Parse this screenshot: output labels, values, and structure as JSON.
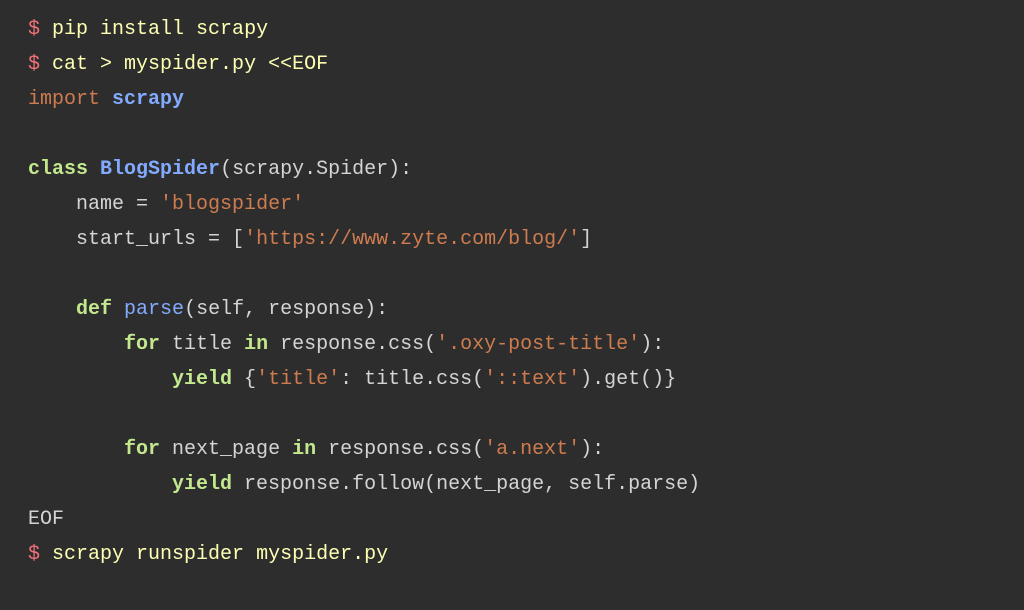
{
  "shell": {
    "prompt": "$",
    "line1_cmd": "pip install scrapy",
    "line2_cmd": "cat > myspider.py <<EOF",
    "line_last": "scrapy runspider myspider.py"
  },
  "py": {
    "kw_import": "import",
    "mod_scrapy": "scrapy",
    "kw_class": "class",
    "class_name": "BlogSpider",
    "base_mod": "scrapy",
    "base_cls": "Spider",
    "attr_name": "name",
    "eq": " = ",
    "name_val": "'blogspider'",
    "attr_urls": "start_urls",
    "urls_open": " = [",
    "urls_val": "'https://www.zyte.com/blog/'",
    "urls_close": "]",
    "kw_def": "def",
    "fn_parse": "parse",
    "parse_args_open": "(",
    "arg_self": "self",
    "comma_sp": ", ",
    "arg_response": "response",
    "parse_args_close": "):",
    "kw_for": "for",
    "var_title": "title",
    "kw_in": "in",
    "resp_css": "response.css(",
    "sel_title": "'.oxy-post-title'",
    "close_paren_colon": "):",
    "kw_yield": "yield",
    "dict_open": " {",
    "dict_key": "'title'",
    "colon_sp": ": ",
    "title_css": "title.css(",
    "sel_text": "'::text'",
    "get_close": ").get()}",
    "var_nextpage": "next_page",
    "sel_next": "'a.next'",
    "follow_call": " response.follow(next_page, ",
    "self_parse": "self",
    "dot_parse": ".parse)",
    "eof": "EOF"
  }
}
